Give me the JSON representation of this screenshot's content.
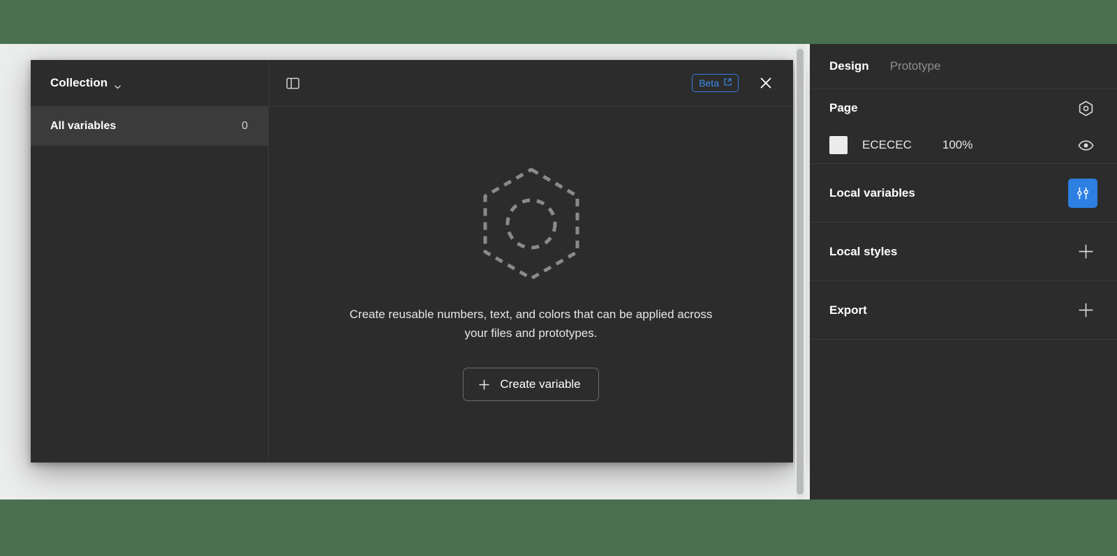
{
  "theme": {
    "desktop_bg": "#4a7050",
    "canvas_bg": "#eceded",
    "panel_bg": "#2c2c2c",
    "selected_row_bg": "#3b3b3b",
    "accent_blue": "#2d7fe2",
    "beta_border": "#2f7fe0",
    "beta_text": "#3c8ceb",
    "divider": "#3a3a3a",
    "text_primary": "#ffffff",
    "text_muted": "#8d8d8d"
  },
  "modal": {
    "header": {
      "collection_label": "Collection",
      "chevron_icon": "chevron-down-icon",
      "panel_toggle_icon": "panel-layout-icon",
      "beta_label": "Beta",
      "beta_external_icon": "external-link-icon",
      "close_icon": "close-icon"
    },
    "sidebar": {
      "items": [
        {
          "label": "All variables",
          "count": "0",
          "selected": true
        }
      ]
    },
    "empty_state": {
      "illustration_icon": "dashed-hexagon-variable-icon",
      "description": "Create reusable numbers, text, and colors that can be applied across your files and prototypes.",
      "create_button_label": "Create variable",
      "create_button_icon": "plus-icon"
    }
  },
  "scrollbar": {
    "orientation": "vertical",
    "name": "canvas-vertical-scrollbar"
  },
  "right_panel": {
    "tabs": [
      {
        "label": "Design",
        "active": true
      },
      {
        "label": "Prototype",
        "active": false
      }
    ],
    "sections": [
      {
        "key": "page",
        "title": "Page",
        "action_icon": "variables-hexagon-icon",
        "row": {
          "swatch_color": "#ececec",
          "hex": "ECECEC",
          "opacity": "100%",
          "visibility_icon": "eye-icon"
        }
      },
      {
        "key": "local_variables",
        "title": "Local variables",
        "action_icon": "sliders-tune-icon",
        "action_highlighted": true
      },
      {
        "key": "local_styles",
        "title": "Local styles",
        "action_icon": "plus-icon"
      },
      {
        "key": "export",
        "title": "Export",
        "action_icon": "plus-icon"
      }
    ]
  }
}
